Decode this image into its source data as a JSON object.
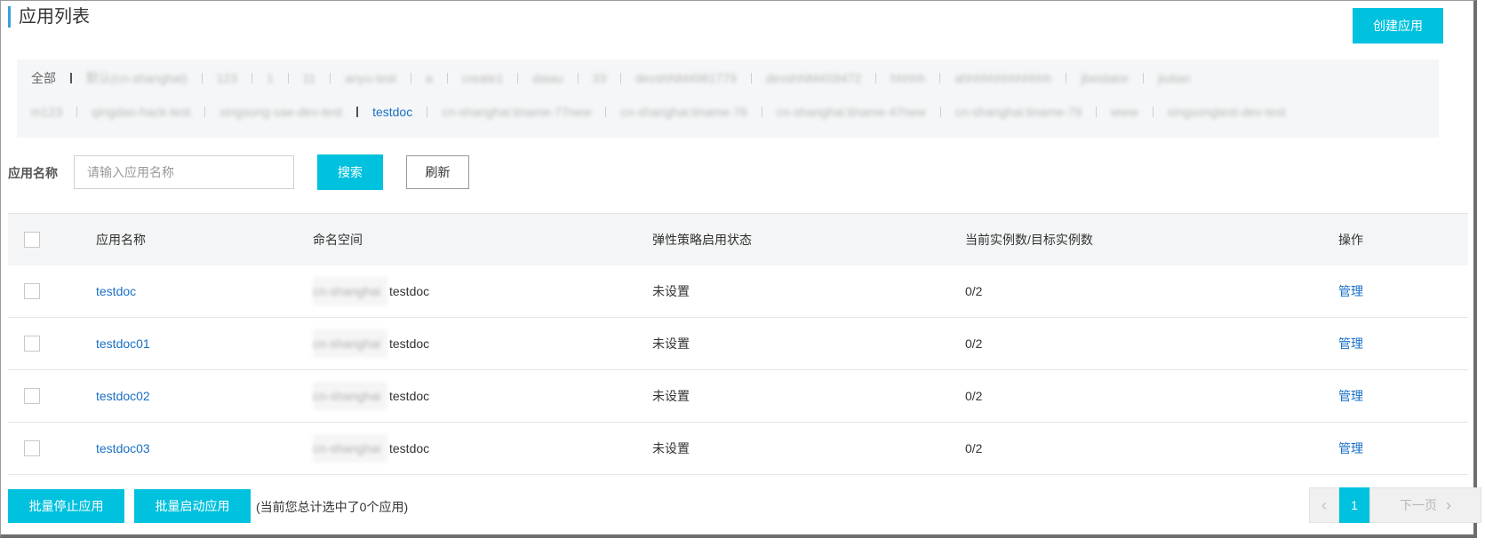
{
  "page": {
    "title": "应用列表"
  },
  "toolbar": {
    "create_label": "创建应用"
  },
  "namespaces": {
    "row1": [
      {
        "label": "全部",
        "state": "normal"
      },
      {
        "label": "默认(cn-shanghai)",
        "state": "blur"
      },
      {
        "label": "123",
        "state": "blur"
      },
      {
        "label": "1",
        "state": "blur"
      },
      {
        "label": "11",
        "state": "blur"
      },
      {
        "label": "anyu-test",
        "state": "blur"
      },
      {
        "label": "a",
        "state": "blur"
      },
      {
        "label": "create1",
        "state": "blur"
      },
      {
        "label": "daiau",
        "state": "blur"
      },
      {
        "label": "33",
        "state": "blur"
      },
      {
        "label": "devshNM4981779",
        "state": "blur"
      },
      {
        "label": "devshNM4S9472",
        "state": "blur"
      },
      {
        "label": "hhhhh",
        "state": "blur"
      },
      {
        "label": "ahhhhhhhhhhhhh",
        "state": "blur"
      },
      {
        "label": "jbeidator",
        "state": "blur"
      },
      {
        "label": "jiutian",
        "state": "blur"
      }
    ],
    "row2": [
      {
        "label": "m123",
        "state": "blur"
      },
      {
        "label": "qingdao-hack-test",
        "state": "blur"
      },
      {
        "label": "xingsong-sae-dev-test",
        "state": "blur"
      },
      {
        "label": "testdoc",
        "state": "active"
      },
      {
        "label": "cn-shanghai:tiname-77new",
        "state": "blur"
      },
      {
        "label": "cn-shanghai:tiname-76",
        "state": "blur"
      },
      {
        "label": "cn-shanghai:tiname-47new",
        "state": "blur"
      },
      {
        "label": "cn-shanghai:tiname-79",
        "state": "blur"
      },
      {
        "label": "www",
        "state": "blur"
      },
      {
        "label": "xingsongtest-dev-test",
        "state": "blur"
      }
    ]
  },
  "search": {
    "label": "应用名称",
    "placeholder": "请输入应用名称",
    "value": "",
    "search_label": "搜索",
    "refresh_label": "刷新"
  },
  "table": {
    "headers": {
      "name": "应用名称",
      "namespace": "命名空间",
      "policy": "弹性策略启用状态",
      "instances": "当前实例数/目标实例数",
      "ops": "操作"
    },
    "rows": [
      {
        "name": "testdoc",
        "ns_region": "cn-shanghai",
        "ns_name": "testdoc",
        "policy": "未设置",
        "instances": "0/2",
        "op": "管理"
      },
      {
        "name": "testdoc01",
        "ns_region": "cn-shanghai",
        "ns_name": "testdoc",
        "policy": "未设置",
        "instances": "0/2",
        "op": "管理"
      },
      {
        "name": "testdoc02",
        "ns_region": "cn-shanghai",
        "ns_name": "testdoc",
        "policy": "未设置",
        "instances": "0/2",
        "op": "管理"
      },
      {
        "name": "testdoc03",
        "ns_region": "cn-shanghai",
        "ns_name": "testdoc",
        "policy": "未设置",
        "instances": "0/2",
        "op": "管理"
      }
    ]
  },
  "footer": {
    "batch_stop_label": "批量停止应用",
    "batch_start_label": "批量启动应用",
    "selected_info": "(当前您总计选中了0个应用)"
  },
  "pagination": {
    "prev_icon": "chevron-left-icon",
    "current_page": "1",
    "next_label": "下一页",
    "next_icon": "chevron-right-icon"
  },
  "colors": {
    "accent": "#00c1de",
    "link": "#1a70c6",
    "title_bar": "#3aa0e0"
  }
}
